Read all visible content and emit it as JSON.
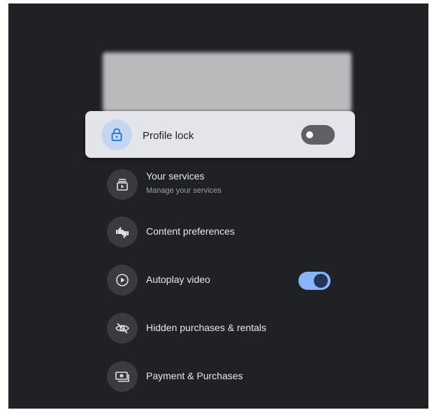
{
  "profile_lock": {
    "label": "Profile lock",
    "enabled": false,
    "icon": "lock-icon"
  },
  "settings": [
    {
      "label": "Your services",
      "sublabel": "Manage your services",
      "icon": "subscriptions-icon"
    },
    {
      "label": "Content preferences",
      "icon": "thumbs-icon"
    },
    {
      "label": "Autoplay video",
      "icon": "play-circle-icon",
      "toggle": true,
      "enabled": true
    },
    {
      "label": "Hidden purchases & rentals",
      "icon": "eye-off-icon"
    },
    {
      "label": "Payment & Purchases",
      "icon": "payment-icon"
    }
  ],
  "colors": {
    "background": "#202125",
    "focus_card": "#e3e5ea",
    "accent": "#8ab4f8",
    "lock_icon": "#1a73e8"
  }
}
